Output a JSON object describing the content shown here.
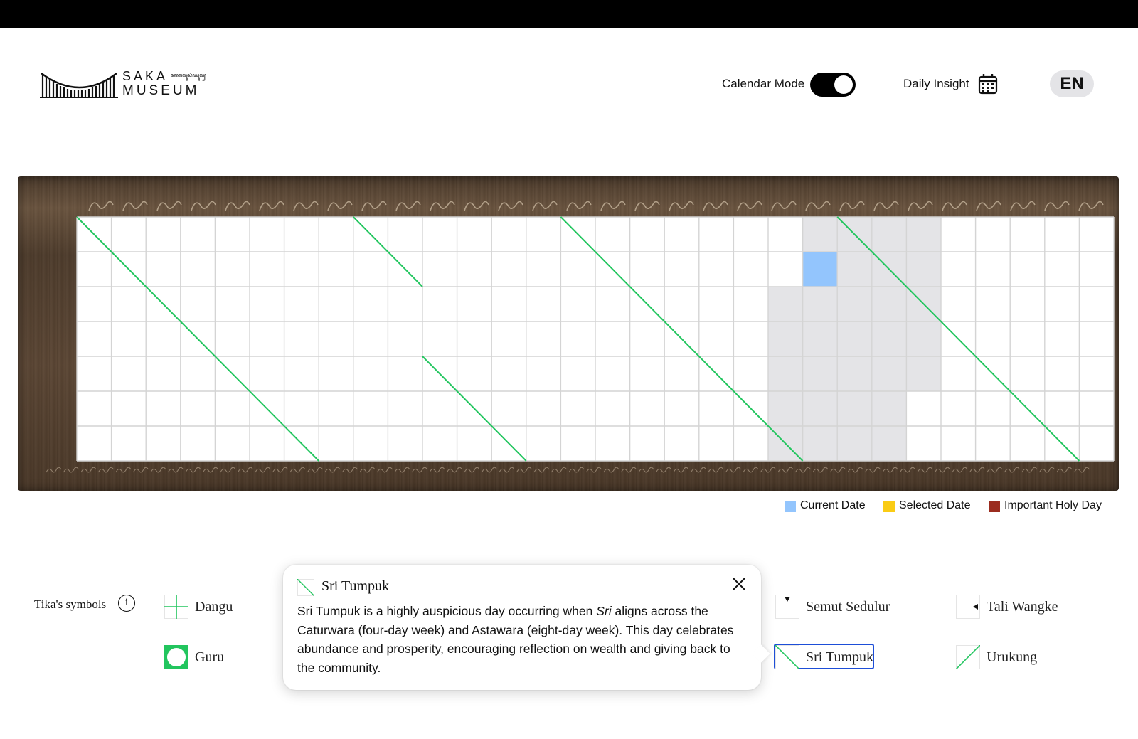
{
  "header": {
    "logo_line1": "SAKA",
    "logo_script": "ꦱꦏꦩꦸꦱꦶꦪꦸꦩ꧀",
    "logo_line2": "MUSEUM",
    "calendar_mode_label": "Calendar Mode",
    "calendar_mode_on": true,
    "daily_insight_label": "Daily Insight",
    "language": "EN"
  },
  "calendar": {
    "columns": 30,
    "rows": 7,
    "current_date": {
      "col": 21,
      "row": 1
    },
    "highlighted_period_cells": [
      [
        21,
        0
      ],
      [
        22,
        0
      ],
      [
        23,
        0
      ],
      [
        24,
        0
      ],
      [
        22,
        1
      ],
      [
        23,
        1
      ],
      [
        24,
        1
      ],
      [
        20,
        2
      ],
      [
        21,
        2
      ],
      [
        22,
        2
      ],
      [
        23,
        2
      ],
      [
        24,
        2
      ],
      [
        20,
        3
      ],
      [
        21,
        3
      ],
      [
        22,
        3
      ],
      [
        23,
        3
      ],
      [
        24,
        3
      ],
      [
        20,
        4
      ],
      [
        21,
        4
      ],
      [
        22,
        4
      ],
      [
        23,
        4
      ],
      [
        24,
        4
      ],
      [
        20,
        5
      ],
      [
        21,
        5
      ],
      [
        22,
        5
      ],
      [
        23,
        5
      ],
      [
        20,
        6
      ],
      [
        21,
        6
      ],
      [
        22,
        6
      ],
      [
        23,
        6
      ]
    ],
    "sri_tumpuk_marks": [
      {
        "from": [
          0,
          0
        ],
        "to": [
          7,
          7
        ]
      },
      {
        "from": [
          8,
          0
        ],
        "to": [
          10,
          2
        ]
      },
      {
        "from": [
          10,
          4
        ],
        "to": [
          13,
          7
        ]
      },
      {
        "from": [
          14,
          0
        ],
        "to": [
          21,
          7
        ]
      },
      {
        "from": [
          22,
          0
        ],
        "to": [
          29,
          7
        ]
      }
    ]
  },
  "legend": [
    {
      "label": "Current Date",
      "color": "#93c5fd"
    },
    {
      "label": "Selected Date",
      "color": "#facc15"
    },
    {
      "label": "Important Holy Day",
      "color": "#9b2c1f"
    }
  ],
  "tika": {
    "title": "Tika's symbols",
    "info_icon": "i",
    "symbols": [
      {
        "name": "Dangu",
        "icon": "plus-icon"
      },
      {
        "name": "Guru",
        "icon": "circle-icon"
      },
      {
        "name": "Semut Sedulur",
        "icon": "triangle-down-icon"
      },
      {
        "name": "Tali Wangke",
        "icon": "triangle-left-icon"
      },
      {
        "name": "Sri Tumpuk",
        "icon": "diagonal-down-icon",
        "selected": true
      },
      {
        "name": "Urukung",
        "icon": "diagonal-up-icon"
      }
    ]
  },
  "popup": {
    "title": "Sri Tumpuk",
    "body_part1": "Sri Tumpuk is a highly auspicious day occurring when ",
    "body_em": "Sri",
    "body_part2": " aligns across the Caturwara (four-day week) and Astawara (eight-day week). This day celebrates abundance and prosperity, encouraging reflection on wealth and giving back to the community."
  },
  "colors": {
    "accent_green": "#22c55e",
    "current_date": "#93c5fd",
    "highlight_period": "#e4e4e7",
    "selected_outline": "#1d4ed8"
  }
}
